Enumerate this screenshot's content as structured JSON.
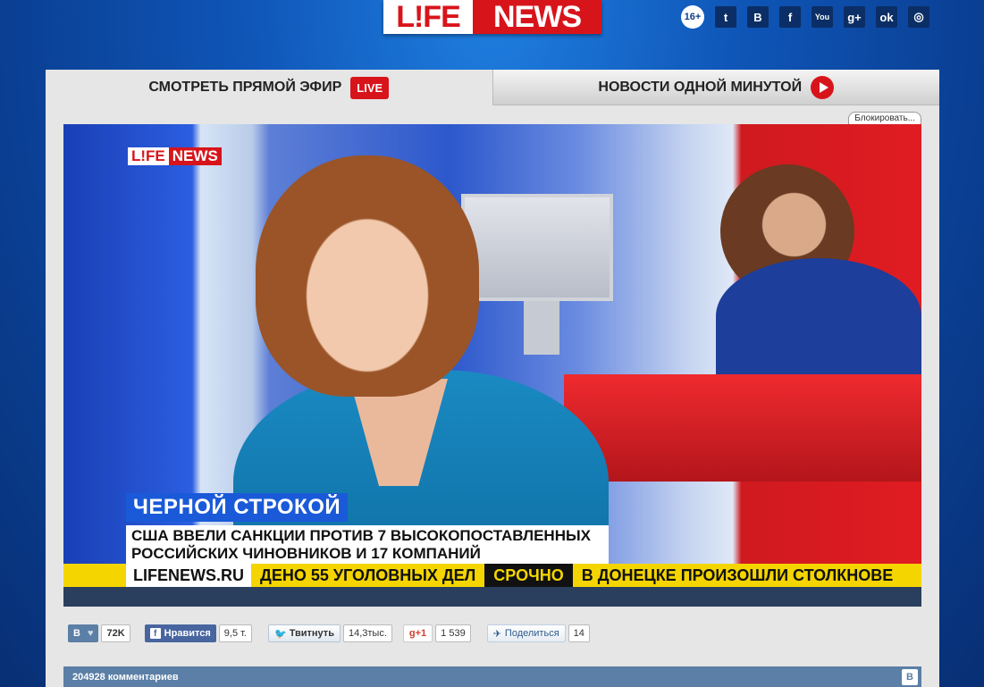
{
  "header": {
    "logo_part1": "L!FE",
    "logo_part2": "NEWS",
    "age_rating": "16+",
    "social": [
      {
        "icon": "twitter-icon",
        "glyph": "🐦"
      },
      {
        "icon": "vk-icon",
        "glyph": "B"
      },
      {
        "icon": "facebook-icon",
        "glyph": "f"
      },
      {
        "icon": "youtube-icon",
        "glyph": "You"
      },
      {
        "icon": "google-plus-icon",
        "glyph": "g+"
      },
      {
        "icon": "odnoklassniki-icon",
        "glyph": "ok"
      },
      {
        "icon": "instagram-icon",
        "glyph": "◎"
      }
    ]
  },
  "tabs": {
    "live_label": "СМОТРЕТЬ ПРЯМОЙ ЭФИР",
    "live_badge": "LIVE",
    "minute_label": "НОВОСТИ ОДНОЙ МИНУТОЙ"
  },
  "block_button": "Блокировать...",
  "video": {
    "logo_part1": "L!FE",
    "logo_part2": "NEWS",
    "strip_title": "ЧЕРНОЙ СТРОКОЙ",
    "subtitle_line1": "США ВВЕЛИ САНКЦИИ ПРОТИВ 7 ВЫСОКОПОСТАВЛЕННЫХ",
    "subtitle_line2": "РОССИЙСКИХ ЧИНОВНИКОВ И 17 КОМПАНИЙ",
    "ticker_site": "LIFENEWS.RU",
    "ticker_text1": "ДЕНО 55 УГОЛОВНЫХ ДЕЛ",
    "ticker_urgent": "СРОЧНО",
    "ticker_text2": "В ДОНЕЦКЕ ПРОИЗОШЛИ СТОЛКНОВЕ"
  },
  "share": {
    "vk_label": "B",
    "vk_count": "72K",
    "fb_label": "Нравится",
    "fb_count": "9,5 т.",
    "tw_label": "Твитнуть",
    "tw_count": "14,3тыс.",
    "gp_label": "g+1",
    "gp_count": "1 539",
    "ml_label": "Поделиться",
    "ml_count": "14"
  },
  "comments": {
    "label": "204928 комментариев",
    "vk_icon": "B"
  }
}
